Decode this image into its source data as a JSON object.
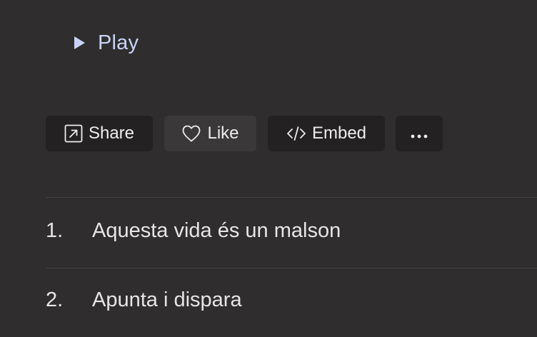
{
  "player": {
    "play_label": "Play",
    "accent_color": "#c8d4f6"
  },
  "actions": {
    "share_label": "Share",
    "like_label": "Like",
    "embed_label": "Embed",
    "more_label": "•••"
  },
  "tracklist": [
    {
      "number": "1.",
      "title": "Aquesta vida és un malson"
    },
    {
      "number": "2.",
      "title": "Apunta i dispara"
    }
  ],
  "icons": {
    "play": "play-icon",
    "share": "external-link-icon",
    "like": "heart-icon",
    "embed": "code-icon",
    "more": "more-horizontal-icon"
  }
}
